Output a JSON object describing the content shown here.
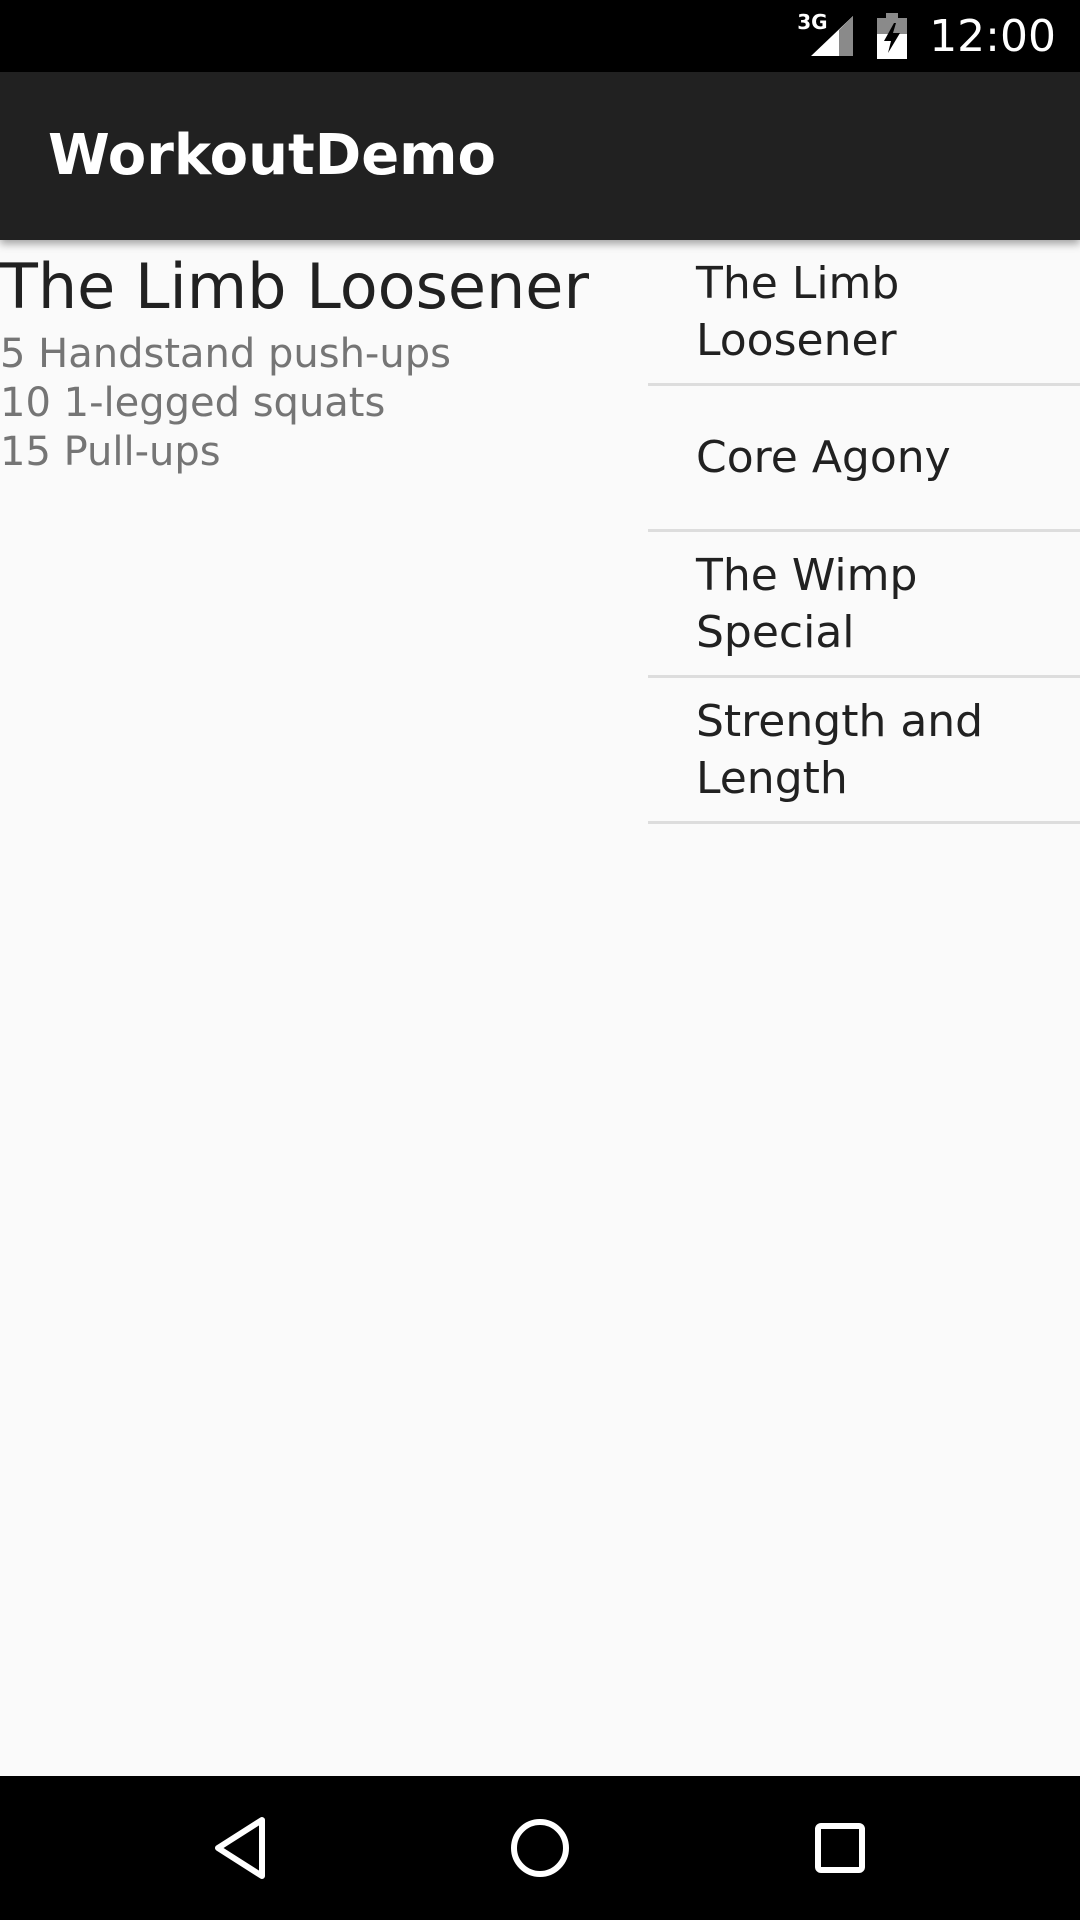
{
  "status_bar": {
    "network_label": "3G",
    "time": "12:00",
    "icons": [
      "signal-icon",
      "battery-charging-icon"
    ]
  },
  "app_bar": {
    "title": "WorkoutDemo"
  },
  "detail": {
    "title": "The Limb Loosener",
    "description": "5 Handstand push-ups\n10 1-legged squats\n15 Pull-ups"
  },
  "workouts": {
    "items": [
      {
        "label": "The Limb Loosener"
      },
      {
        "label": "Core Agony"
      },
      {
        "label": "The Wimp Special"
      },
      {
        "label": "Strength and Length"
      }
    ]
  },
  "nav_bar": {
    "icons": [
      "back-icon",
      "home-icon",
      "recents-icon"
    ]
  },
  "colors": {
    "status_bar": "#000000",
    "app_bar": "#212121",
    "background": "#fafafa",
    "primary_text": "#212121",
    "secondary_text": "#757575",
    "divider": "#dddddd"
  }
}
